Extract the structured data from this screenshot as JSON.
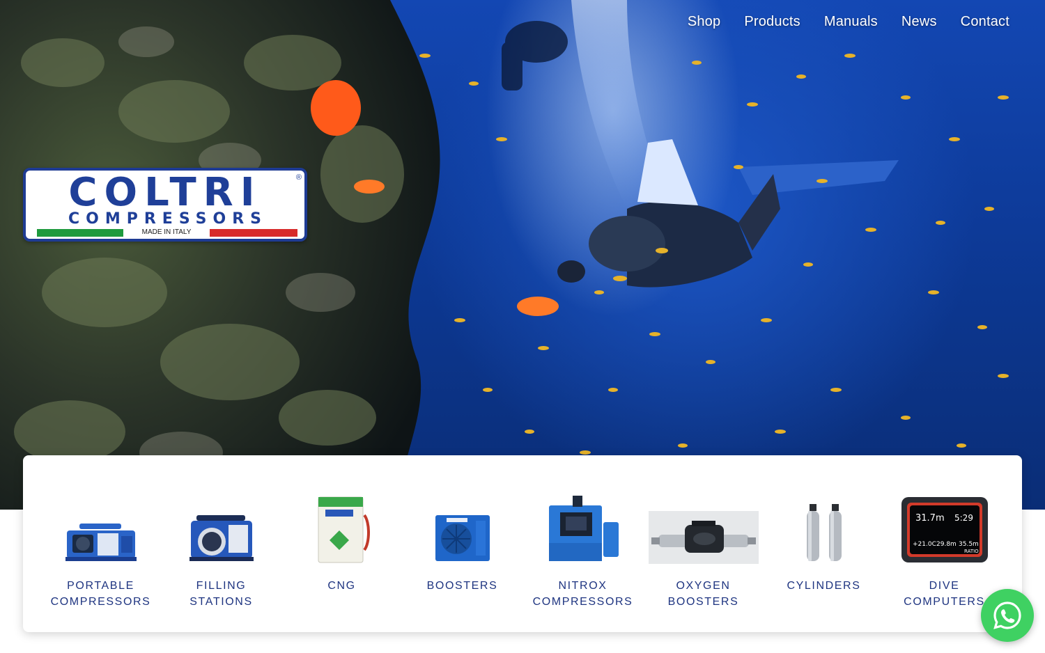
{
  "nav": {
    "items": [
      {
        "label": "Shop"
      },
      {
        "label": "Products"
      },
      {
        "label": "Manuals"
      },
      {
        "label": "News"
      },
      {
        "label": "Contact"
      }
    ]
  },
  "logo": {
    "main": "COLTRI",
    "sub": "COMPRESSORS",
    "tagline": "MADE IN ITALY",
    "registered": "®"
  },
  "products": [
    {
      "line1": "PORTABLE",
      "line2": "COMPRESSORS",
      "icon": "portable-compressor-icon"
    },
    {
      "line1": "FILLING",
      "line2": "STATIONS",
      "icon": "filling-station-icon"
    },
    {
      "line1": "CNG",
      "line2": "",
      "icon": "cng-unit-icon"
    },
    {
      "line1": "BOOSTERS",
      "line2": "",
      "icon": "booster-icon"
    },
    {
      "line1": "NITROX",
      "line2": "COMPRESSORS",
      "icon": "nitrox-compressor-icon"
    },
    {
      "line1": "OXYGEN",
      "line2": "BOOSTERS",
      "icon": "oxygen-booster-icon"
    },
    {
      "line1": "CYLINDERS",
      "line2": "",
      "icon": "cylinders-icon"
    },
    {
      "line1": "DIVE",
      "line2": "COMPUTERS",
      "icon": "dive-computer-icon"
    }
  ],
  "dive_computer_screen": {
    "depth": "31.7m",
    "time": "5:29",
    "temp": "+21.0C",
    "avg": "29.8m",
    "max": "35.5m",
    "brand": "RATIO"
  },
  "colors": {
    "brand_blue": "#1f3f98",
    "label_blue": "#1e3480",
    "whatsapp_green": "#3fd162",
    "flag_green": "#1e9a3d",
    "flag_red": "#d72a2a"
  }
}
